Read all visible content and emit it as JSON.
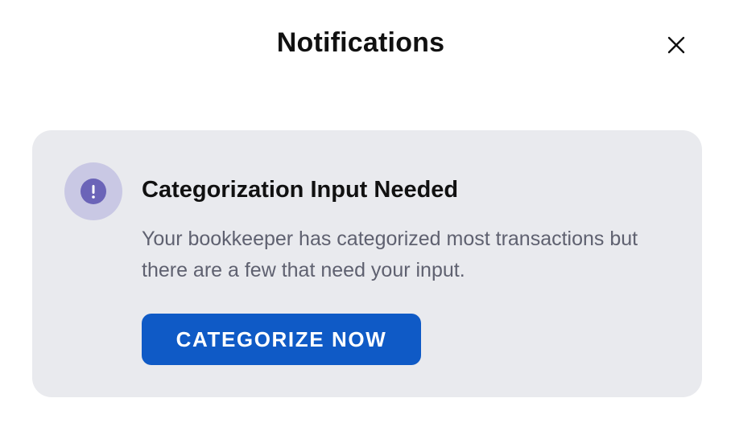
{
  "header": {
    "title": "Notifications",
    "close_icon": "close-icon"
  },
  "notification": {
    "icon": "exclamation-icon",
    "title": "Categorization Input Needed",
    "body": "Your bookkeeper has categorized most transactions but there are a few that need your input.",
    "button_label": "CATEGORIZE NOW"
  },
  "colors": {
    "card_background": "#e9eaee",
    "icon_outer": "#c9c8e4",
    "icon_inner": "#6b64b8",
    "button_background": "#0f5ac6",
    "body_text": "#5f6170"
  }
}
